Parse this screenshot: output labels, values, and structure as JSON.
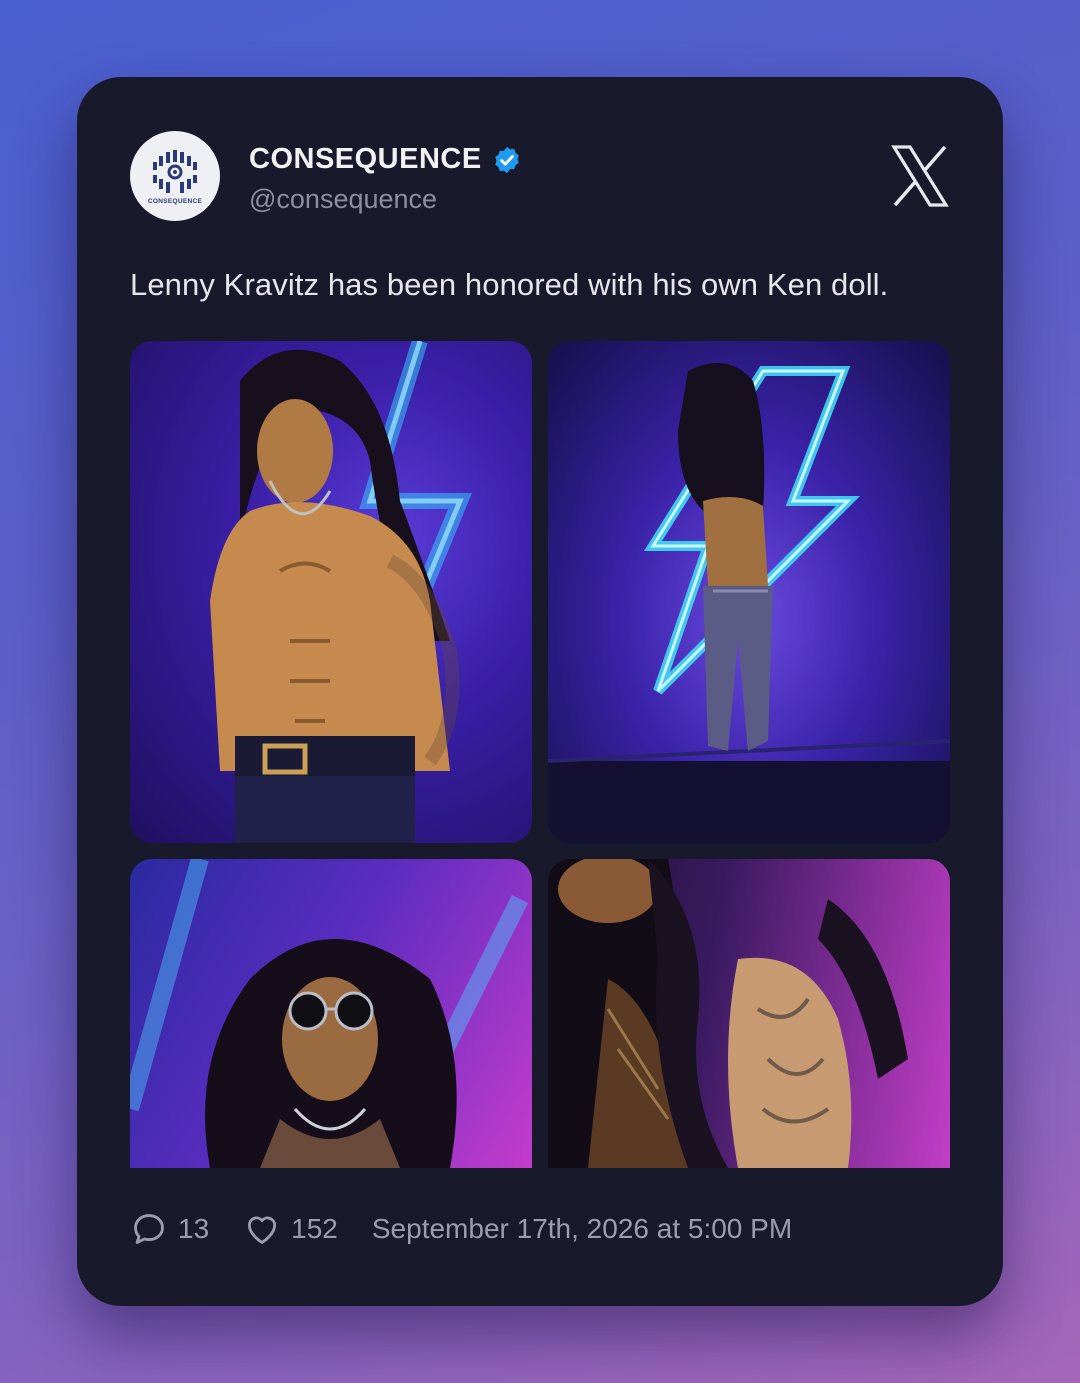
{
  "account": {
    "avatar_text": "CONSEQUENCE",
    "display_name": "CONSEQUENCE",
    "handle": "@consequence",
    "verified": true
  },
  "tweet": {
    "text": "Lenny Kravitz has been honored with his own Ken doll."
  },
  "images": [
    {
      "name": "doll-front-shirtless"
    },
    {
      "name": "doll-back-lightning"
    },
    {
      "name": "doll-sunglasses"
    },
    {
      "name": "doll-tattoo-closeup"
    }
  ],
  "stats": {
    "replies": "13",
    "likes": "152",
    "timestamp": "September 17th, 2026 at 5:00 PM"
  },
  "colors": {
    "card_bg": "#181a2b",
    "verified_badge": "#1d9bf0",
    "muted_text": "#9a9db2"
  },
  "icons": {
    "platform": "x-logo-icon",
    "verified": "verified-badge-icon",
    "reply": "comment-icon",
    "like": "heart-icon"
  }
}
